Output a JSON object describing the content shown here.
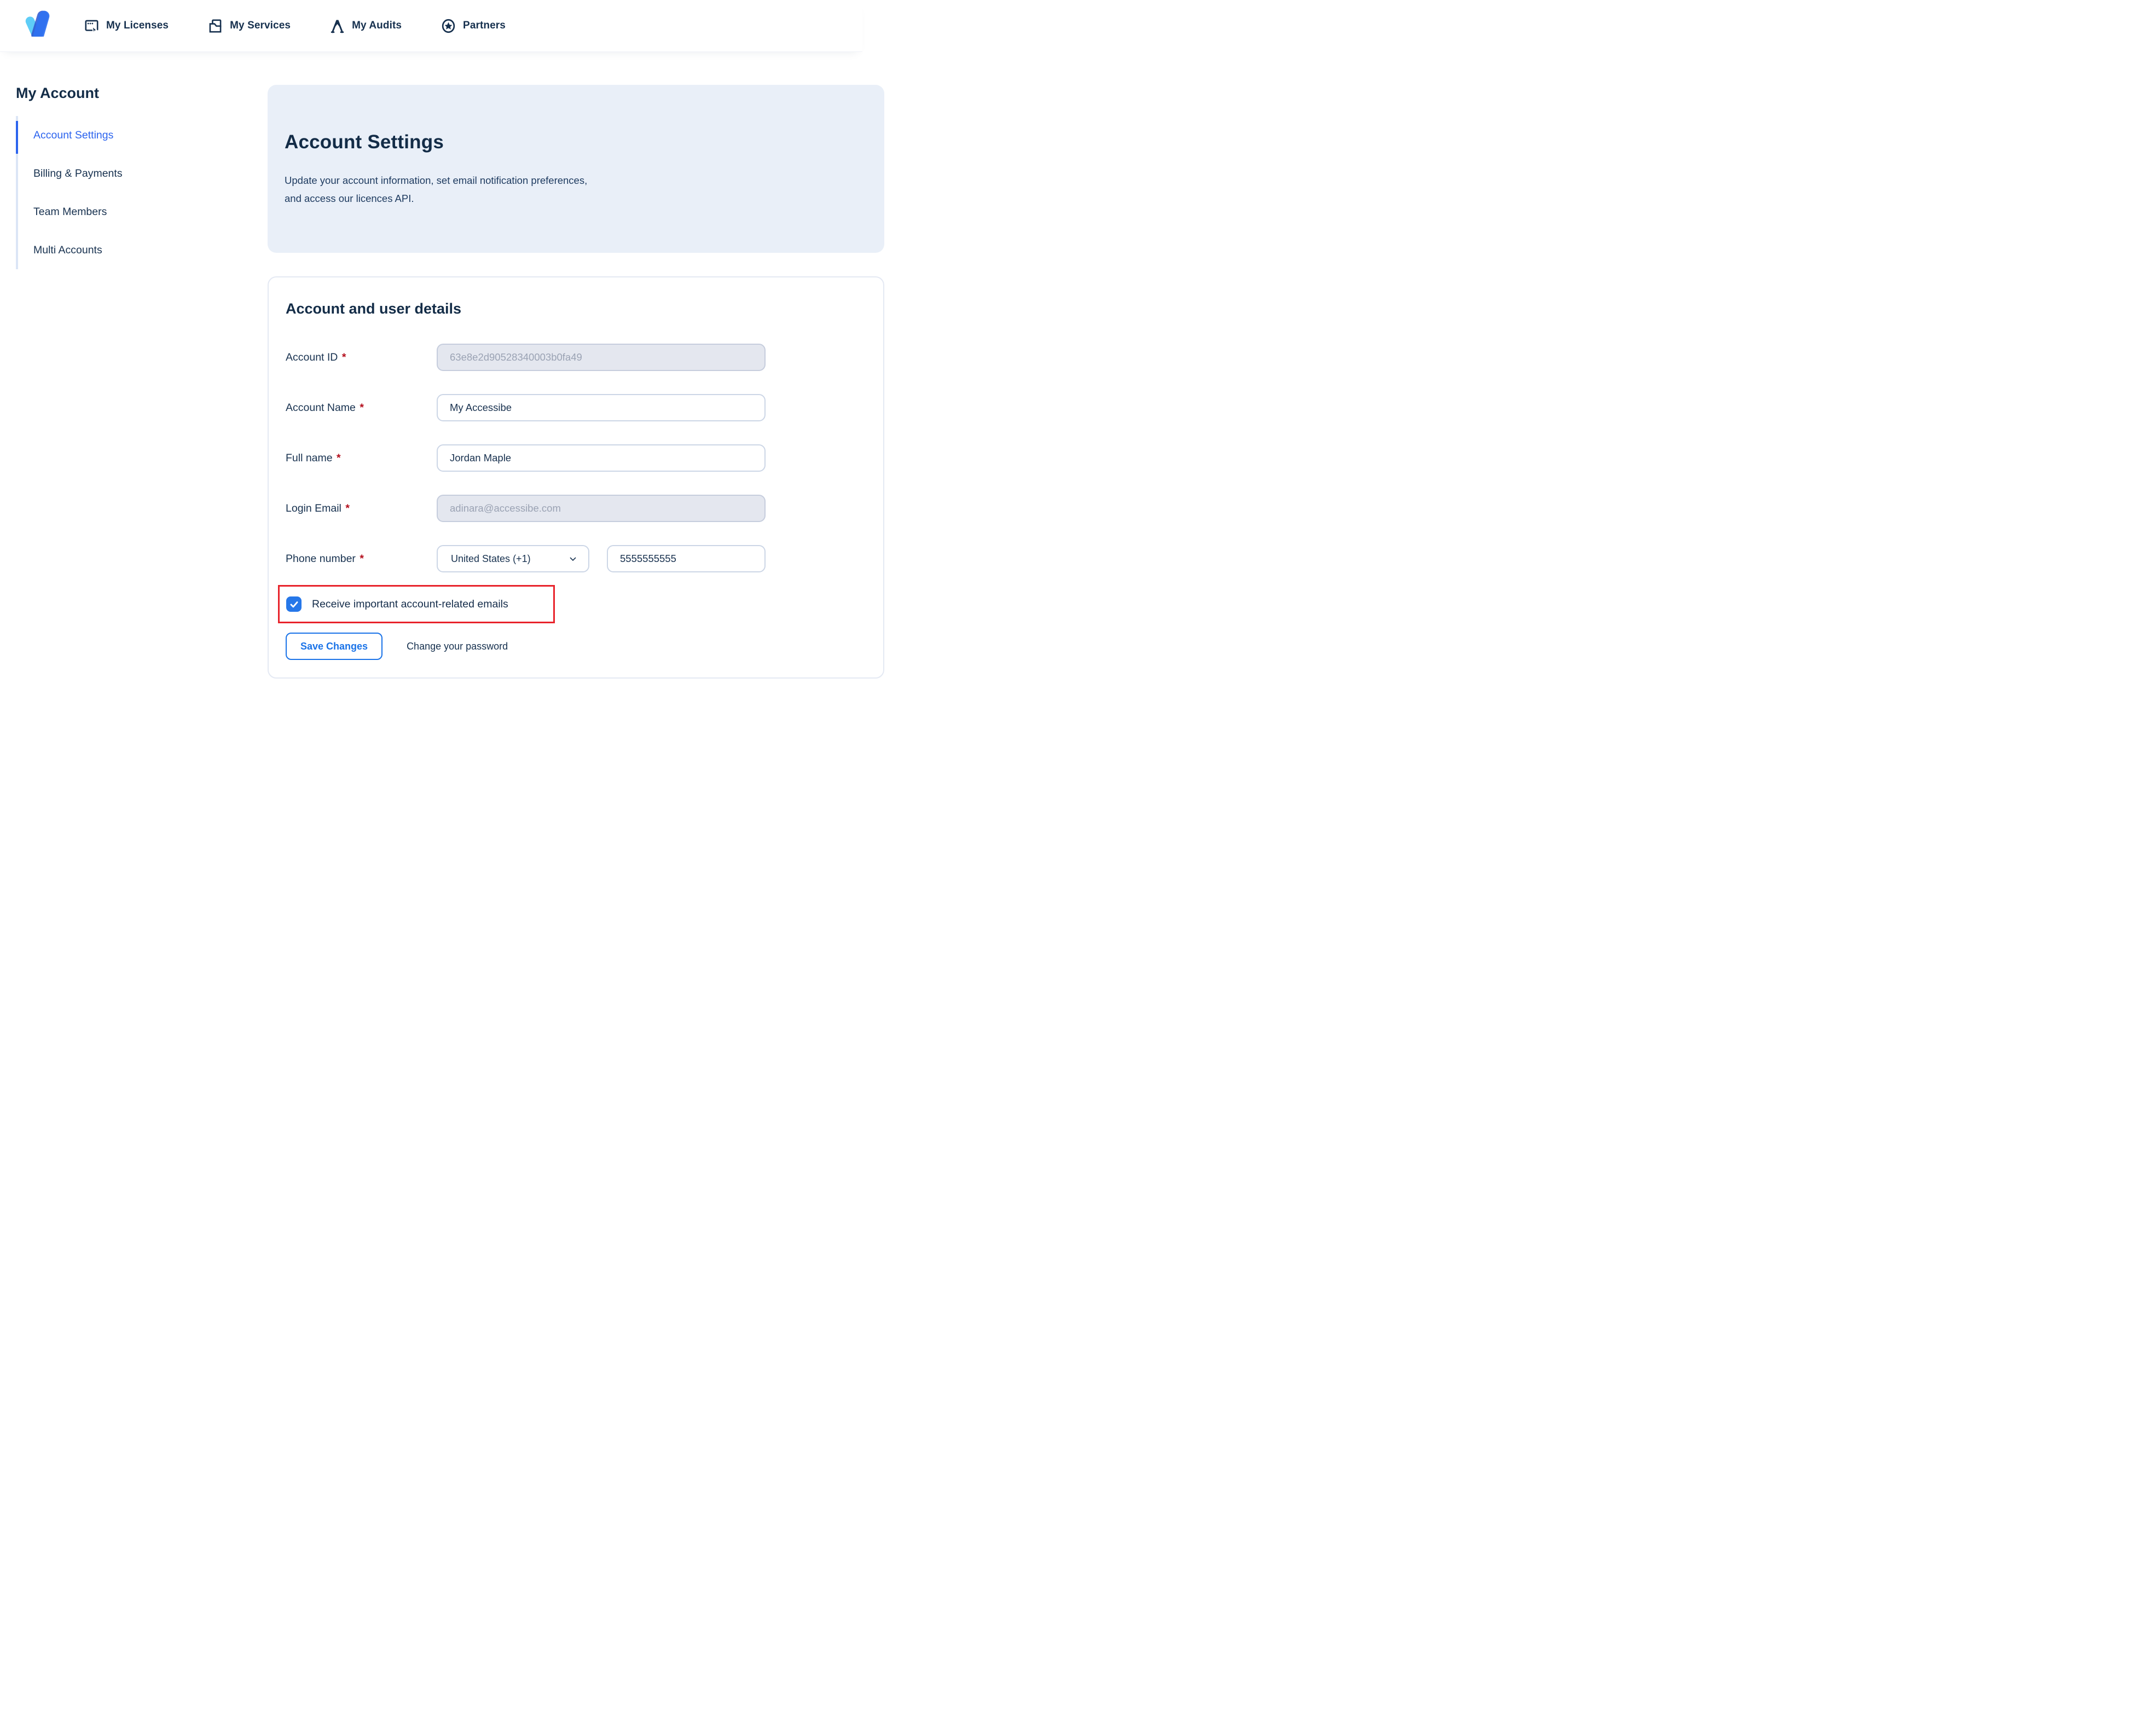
{
  "nav": {
    "items": [
      {
        "label": "My Licenses",
        "icon": "licenses-icon"
      },
      {
        "label": "My Services",
        "icon": "services-icon"
      },
      {
        "label": "My Audits",
        "icon": "audits-icon"
      },
      {
        "label": "Partners",
        "icon": "partners-icon"
      }
    ]
  },
  "sidebar": {
    "title": "My Account",
    "items": [
      {
        "label": "Account Settings",
        "active": true
      },
      {
        "label": "Billing & Payments",
        "active": false
      },
      {
        "label": "Team Members",
        "active": false
      },
      {
        "label": "Multi Accounts",
        "active": false
      }
    ]
  },
  "hero": {
    "title": "Account Settings",
    "description_line1": "Update your account information, set email notification preferences,",
    "description_line2": "and access our licences API."
  },
  "form": {
    "section_title": "Account and user details",
    "required_mark": "*",
    "fields": {
      "account_id": {
        "label": "Account ID",
        "value": "63e8e2d90528340003b0fa49",
        "disabled": true
      },
      "account_name": {
        "label": "Account Name",
        "value": "My Accessibe",
        "disabled": false
      },
      "full_name": {
        "label": "Full name",
        "value": "Jordan Maple",
        "disabled": false
      },
      "login_email": {
        "label": "Login Email",
        "value": "adinara@accessibe.com",
        "disabled": true
      },
      "phone": {
        "label": "Phone number",
        "country": "United States (+1)",
        "number": "5555555555"
      }
    },
    "checkbox": {
      "label": "Receive important account-related emails",
      "checked": true
    },
    "actions": {
      "save": "Save Changes",
      "change_password": "Change your password"
    }
  },
  "colors": {
    "accent_link": "#2b63ee",
    "control_blue": "#1a73e8",
    "checkbox_blue": "#2677e9",
    "navy_text": "#16304e",
    "hero_bg": "#e9eff8",
    "annotation_red": "#e8232b",
    "logo_light_blue": "#5ecdf7",
    "logo_blue": "#2e71f1"
  }
}
